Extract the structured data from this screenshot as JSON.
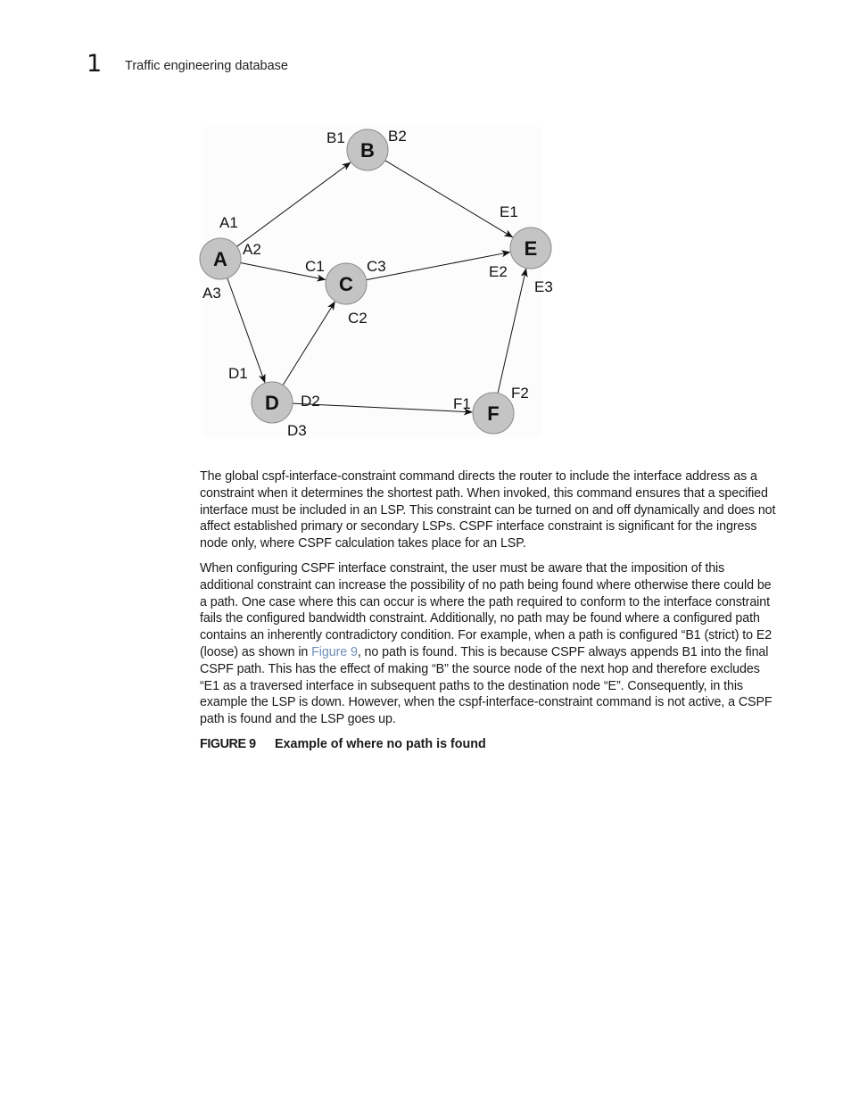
{
  "header": {
    "chapter_number": "1",
    "running_title": "Traffic engineering database"
  },
  "figure": {
    "nodes": [
      {
        "id": "A",
        "label": "A"
      },
      {
        "id": "B",
        "label": "B"
      },
      {
        "id": "C",
        "label": "C"
      },
      {
        "id": "D",
        "label": "D"
      },
      {
        "id": "E",
        "label": "E"
      },
      {
        "id": "F",
        "label": "F"
      }
    ],
    "edges": [
      {
        "from": "A",
        "to": "B",
        "from_iface": "A1",
        "to_iface": "B1"
      },
      {
        "from": "A",
        "to": "C",
        "from_iface": "A2",
        "to_iface": "C1"
      },
      {
        "from": "A",
        "to": "D",
        "from_iface": "A3",
        "to_iface": "D1"
      },
      {
        "from": "B",
        "to": "E",
        "from_iface": "B2",
        "to_iface": "E1"
      },
      {
        "from": "C",
        "to": "E",
        "from_iface": "C3",
        "to_iface": "E2"
      },
      {
        "from": "D",
        "to": "C",
        "from_iface": "D2",
        "to_iface": "C2"
      },
      {
        "from": "D",
        "to": "F",
        "from_iface": "D3",
        "to_iface": "F1"
      },
      {
        "from": "F",
        "to": "E",
        "from_iface": "F2",
        "to_iface": "E3"
      }
    ],
    "interface_labels": {
      "A1": "A1",
      "A2": "A2",
      "A3": "A3",
      "B1": "B1",
      "B2": "B2",
      "C1": "C1",
      "C2": "C2",
      "C3": "C3",
      "D1": "D1",
      "D2": "D2",
      "D3": "D3",
      "E1": "E1",
      "E2": "E2",
      "E3": "E3",
      "F1": "F1",
      "F2": "F2"
    },
    "node_fill": "#c4c4c4",
    "caption_number": "FIGURE 9",
    "caption_title": "Example of where no path is found"
  },
  "paragraphs": {
    "p1": "The global cspf-interface-constraint command directs the router to include the interface address as a constraint when it determines the shortest path. When invoked, this command ensures that a specified interface must be included in an LSP. This constraint can be turned on and off dynamically and does not affect established primary or secondary LSPs. CSPF interface constraint is significant for the ingress node only, where CSPF calculation takes place for an LSP.",
    "p2_before_link": "When configuring CSPF interface constraint, the user must be aware that the imposition of this additional constraint can increase the possibility of no path being found where otherwise there could be a path. One case where this can occur is where the path required to conform to the interface constraint fails the configured bandwidth constraint. Additionally, no path may be found where a configured path contains an inherently contradictory condition. For example, when a path is configured “B1 (strict) to E2 (loose) as shown in ",
    "p2_link": "Figure 9",
    "p2_after_link": ", no path is found. This is because CSPF always appends B1 into the final CSPF path. This has the effect of making “B” the source node of the next hop and therefore excludes “E1 as a traversed interface in subsequent paths to the destination node “E”. Consequently, in this example the LSP is down. However, when the cspf-interface-constraint command is not active, a CSPF path is found and the LSP goes up."
  },
  "colors": {
    "link": "#6f8fb8",
    "text": "#1a1a1a"
  }
}
